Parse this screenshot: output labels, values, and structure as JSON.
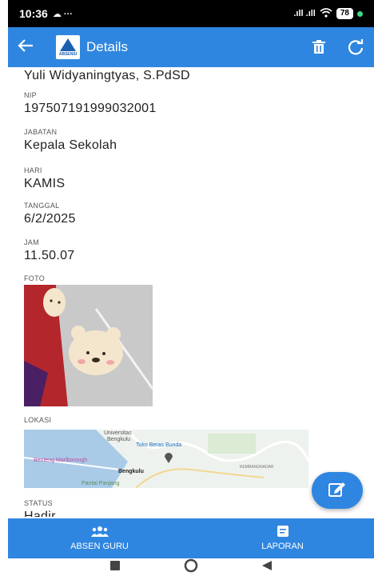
{
  "status_bar": {
    "time": "10:36",
    "extra": "☁ ···",
    "signal": ".ıll .ıll",
    "battery": "78"
  },
  "app_bar": {
    "title": "Details",
    "logo_text": "ABSENSI",
    "icons": [
      "back-arrow-icon",
      "trash-icon",
      "refresh-icon"
    ]
  },
  "details": {
    "name": "Yuli Widyaningtyas, S.PdSD",
    "nip_label": "NIP",
    "nip": "197507191999032001",
    "jabatan_label": "JABATAN",
    "jabatan": "Kepala Sekolah",
    "hari_label": "HARI",
    "hari": "KAMIS",
    "tanggal_label": "TANGGAL",
    "tanggal": "6/2/2025",
    "jam_label": "JAM",
    "jam": "11.50.07",
    "foto_label": "FOTO",
    "lokasi_label": "LOKASI",
    "status_label": "STATUS",
    "status": "Hadir"
  },
  "map": {
    "labels": {
      "univ": "Universitas",
      "univ2": "Bengkulu",
      "toko": "Toko Beras Bunda",
      "benteng": "Benteng Marlborough",
      "bengkulu": "Bengkulu",
      "kembangnadar": "KEMBANGNADAR",
      "pantai": "Pantai Panjang"
    }
  },
  "bottom_nav": {
    "absen_label": "ABSEN GURU",
    "laporan_label": "LAPORAN"
  },
  "colors": {
    "primary": "#2f86e0"
  }
}
